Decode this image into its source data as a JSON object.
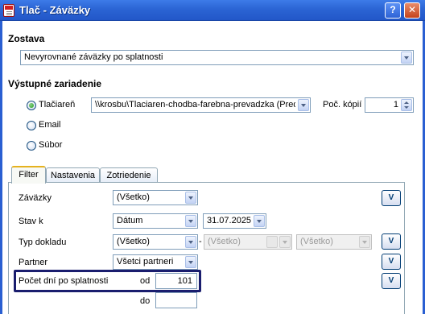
{
  "window": {
    "title": "Tlač - Záväzky"
  },
  "zostava": {
    "label": "Zostava",
    "value": "Nevyrovnané záväzky po splatnosti"
  },
  "output": {
    "label": "Výstupné zariadenie",
    "printer": {
      "label": "Tlačiareň",
      "value": "\\\\krosbu\\Tlaciaren-chodba-farebna-prevadzka (Pred"
    },
    "copies": {
      "label": "Poč. kópií",
      "value": "1"
    },
    "email_label": "Email",
    "file_label": "Súbor"
  },
  "tabs": [
    "Filter",
    "Nastavenia",
    "Zotriedenie"
  ],
  "filter": {
    "v_label": "V",
    "zavazky": {
      "label": "Záväzky",
      "value": "(Všetko)"
    },
    "stav": {
      "label": "Stav k",
      "value": "Dátum",
      "date": "31.07.2025"
    },
    "typ": {
      "label": "Typ dokladu",
      "value": "(Všetko)",
      "dash": "-",
      "from": "(Všetko)",
      "to": "(Všetko)"
    },
    "partner": {
      "label": "Partner",
      "value": "Všetci partneri"
    },
    "pocet": {
      "label": "Počet dní po splatnosti",
      "od_label": "od",
      "od_value": "101",
      "do_label": "do",
      "do_value": ""
    }
  },
  "colors": {
    "titlebar": "#2b64d4",
    "tab_active_top": "#e5b21f",
    "highlight": "#1a1d6e"
  }
}
